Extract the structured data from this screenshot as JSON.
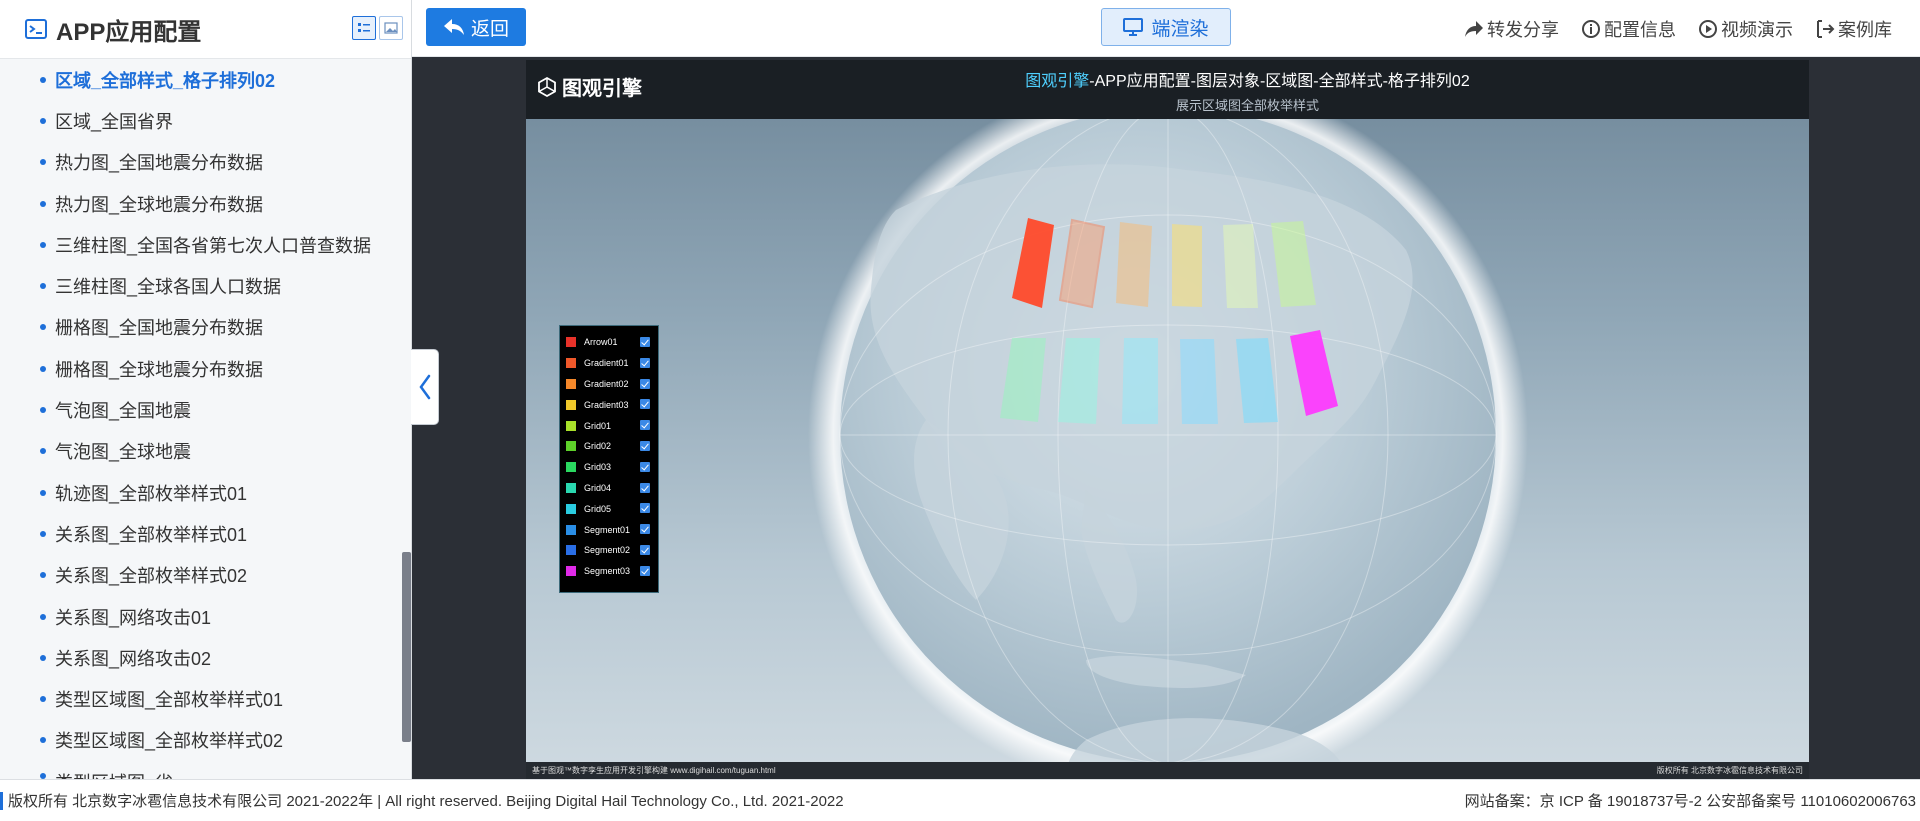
{
  "sidebar": {
    "title": "APP应用配置",
    "items": [
      {
        "label": "区域_全部样式_格子排列02",
        "active": true
      },
      {
        "label": "区域_全国省界"
      },
      {
        "label": "热力图_全国地震分布数据"
      },
      {
        "label": "热力图_全球地震分布数据"
      },
      {
        "label": "三维柱图_全国各省第七次人口普查数据"
      },
      {
        "label": "三维柱图_全球各国人口数据"
      },
      {
        "label": "栅格图_全国地震分布数据"
      },
      {
        "label": "栅格图_全球地震分布数据"
      },
      {
        "label": "气泡图_全国地震"
      },
      {
        "label": "气泡图_全球地震"
      },
      {
        "label": "轨迹图_全部枚举样式01"
      },
      {
        "label": "关系图_全部枚举样式01"
      },
      {
        "label": "关系图_全部枚举样式02"
      },
      {
        "label": "关系图_网络攻击01"
      },
      {
        "label": "关系图_网络攻击02"
      },
      {
        "label": "类型区域图_全部枚举样式01"
      },
      {
        "label": "类型区域图_全部枚举样式02"
      },
      {
        "label": "类型区域图_省"
      }
    ]
  },
  "topbar": {
    "back_label": "返回",
    "render_label": "端渲染",
    "share_label": "转发分享",
    "config_label": "配置信息",
    "video_label": "视频演示",
    "cases_label": "案例库"
  },
  "viewer": {
    "logo_text": "图观引擎",
    "title_accent": "图观引擎",
    "title_rest": "-APP应用配置-图层对象-区域图-全部样式-格子排列02",
    "subtitle": "展示区域图全部枚举样式",
    "footer_left": "基于图观™数字孪生应用开发引擎构建 www.digihail.com/tuguan.html",
    "footer_right": "版权所有 北京数字冰雹信息技术有限公司"
  },
  "legend": [
    {
      "label": "Arrow01",
      "color": "#e8322a",
      "checked": true
    },
    {
      "label": "Gradient01",
      "color": "#f0582a",
      "checked": true
    },
    {
      "label": "Gradient02",
      "color": "#f5882a",
      "checked": true
    },
    {
      "label": "Gradient03",
      "color": "#f0c82a",
      "checked": true
    },
    {
      "label": "Grid01",
      "color": "#a8e02a",
      "checked": true
    },
    {
      "label": "Grid02",
      "color": "#5ed02a",
      "checked": true
    },
    {
      "label": "Grid03",
      "color": "#2ad860",
      "checked": true
    },
    {
      "label": "Grid04",
      "color": "#2ad8b0",
      "checked": true
    },
    {
      "label": "Grid05",
      "color": "#2acce0",
      "checked": true
    },
    {
      "label": "Segment01",
      "color": "#2a8ee6",
      "checked": true
    },
    {
      "label": "Segment02",
      "color": "#2a6ee6",
      "checked": true
    },
    {
      "label": "Segment03",
      "color": "#e02ae8",
      "checked": true
    }
  ],
  "footer": {
    "copyright": "版权所有 北京数字冰雹信息技术有限公司 2021-2022年 | All right reserved. Beijing Digital Hail Technology Co., Ltd. 2021-2022",
    "icp": "网站备案：京 ICP 备 19018737号-2 公安部备案号 11010602006763"
  },
  "colors": {
    "accent": "#1e6fd9",
    "title_accent": "#4fd0ff"
  }
}
